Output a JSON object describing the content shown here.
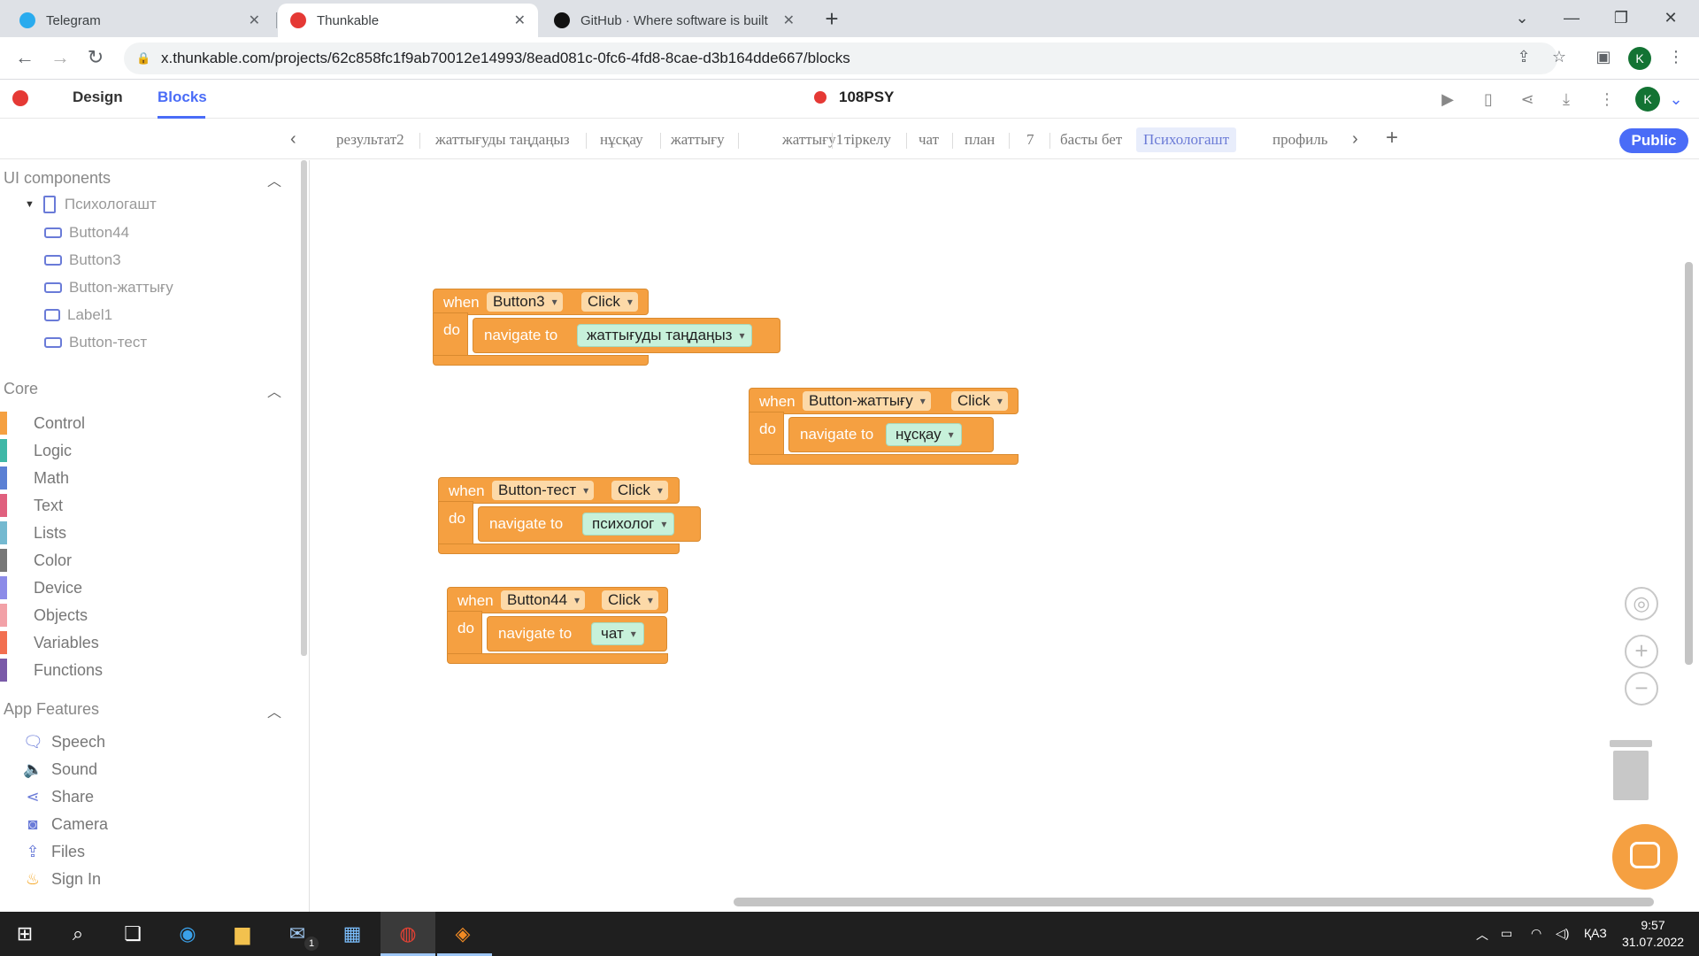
{
  "browser": {
    "tabs": [
      {
        "title": "Telegram",
        "color": "#2aabee",
        "close": "✕"
      },
      {
        "title": "Thunkable",
        "color": "#e53935",
        "close": "✕"
      },
      {
        "title": "GitHub · Where software is built",
        "color": "#111111",
        "close": "✕"
      }
    ],
    "new_tab": "+",
    "url": "x.thunkable.com/projects/62c858fc1f9ab70012e14993/8ead081c-0fc6-4fd8-8cae-d3b164dde667/blocks",
    "profile_initial": "K"
  },
  "app": {
    "nav": {
      "design": "Design",
      "blocks": "Blocks"
    },
    "project_name": "108PSY",
    "profile_initial": "K",
    "screens": [
      "результат2",
      "жаттығуды таңдаңыз",
      "нұсқау",
      "жаттығу",
      "жаттығу1",
      "тіркелу",
      "чат",
      "план",
      "7",
      "басты бет",
      "Психологашт",
      "профиль"
    ],
    "active_screen": "Психологашт",
    "public_label": "Public",
    "brand_color": "#4a6cf7"
  },
  "palette": {
    "ui_components": {
      "heading": "UI components",
      "screen": "Психологашт",
      "items": [
        "Button44",
        "Button3",
        "Button-жаттығу",
        "Label1",
        "Button-тест"
      ]
    },
    "core": {
      "heading": "Core",
      "items": [
        {
          "label": "Control",
          "color": "#f5a041"
        },
        {
          "label": "Logic",
          "color": "#3fb8a7"
        },
        {
          "label": "Math",
          "color": "#5b80d4"
        },
        {
          "label": "Text",
          "color": "#e0607e"
        },
        {
          "label": "Lists",
          "color": "#74b9d0"
        },
        {
          "label": "Color",
          "color": "#777777"
        },
        {
          "label": "Device",
          "color": "#8c8be8"
        },
        {
          "label": "Objects",
          "color": "#f2a1a7"
        },
        {
          "label": "Variables",
          "color": "#f26f50"
        },
        {
          "label": "Functions",
          "color": "#7a5aa8"
        }
      ]
    },
    "app_features": {
      "heading": "App Features",
      "items": [
        {
          "label": "Speech",
          "icon": "speech-icon"
        },
        {
          "label": "Sound",
          "icon": "sound-icon"
        },
        {
          "label": "Share",
          "icon": "share-icon"
        },
        {
          "label": "Camera",
          "icon": "camera-icon"
        },
        {
          "label": "Files",
          "icon": "files-icon"
        },
        {
          "label": "Sign In",
          "icon": "firebase-icon"
        }
      ]
    }
  },
  "blocks": [
    {
      "when": "when",
      "component": "Button3",
      "event": "Click",
      "do": "do",
      "action": "navigate to",
      "target": "жаттығуды таңдаңыз"
    },
    {
      "when": "when",
      "component": "Button-жаттығу",
      "event": "Click",
      "do": "do",
      "action": "navigate to",
      "target": "нұсқау"
    },
    {
      "when": "when",
      "component": "Button-тест",
      "event": "Click",
      "do": "do",
      "action": "navigate to",
      "target": "психолог"
    },
    {
      "when": "when",
      "component": "Button44",
      "event": "Click",
      "do": "do",
      "action": "navigate to",
      "target": "чат"
    }
  ],
  "taskbar": {
    "language": "ҚАЗ",
    "time": "9:57",
    "date": "31.07.2022",
    "mail_badge": "1"
  }
}
